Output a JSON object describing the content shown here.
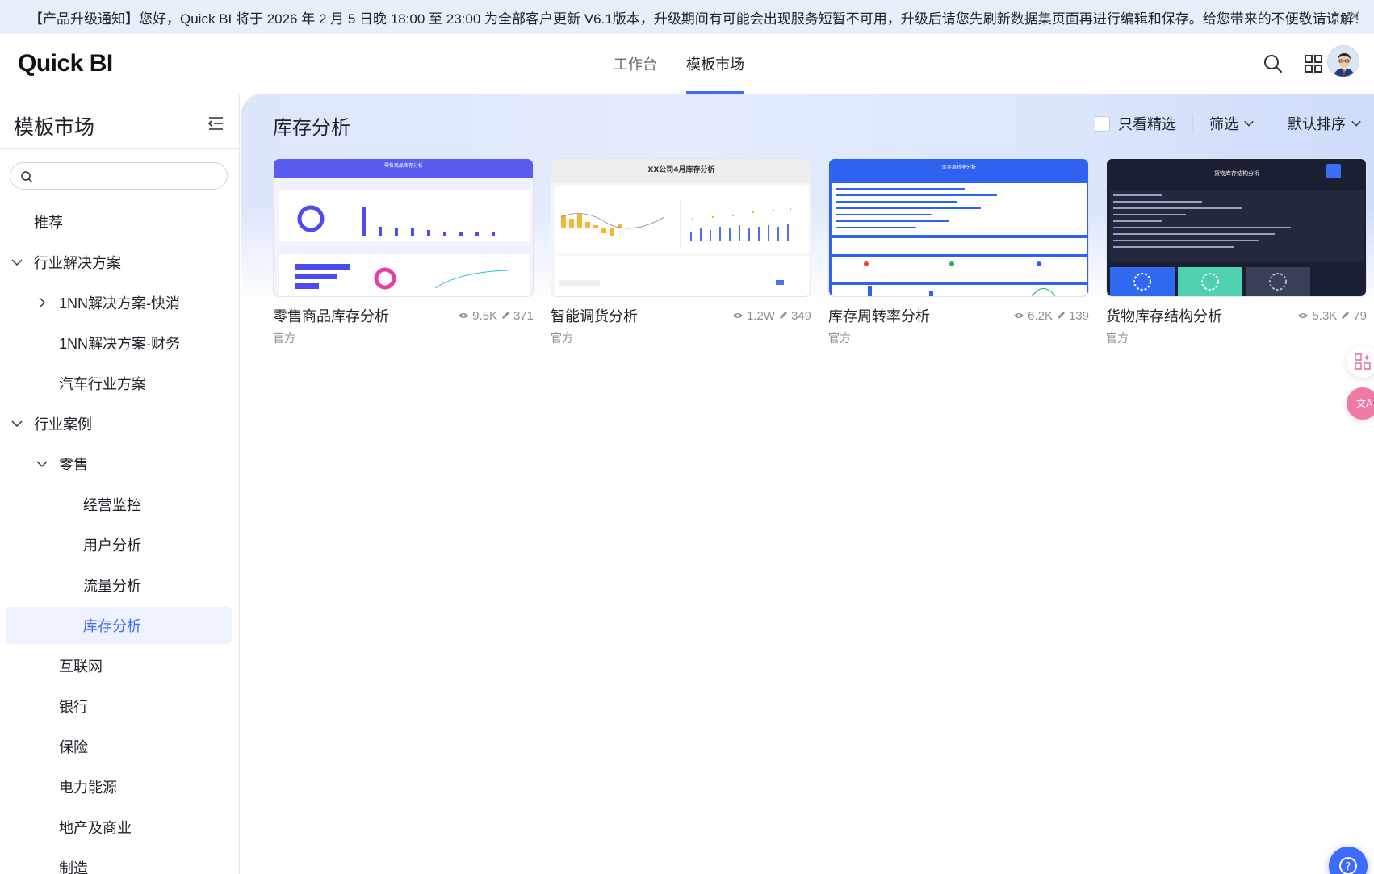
{
  "banner": {
    "text": "【产品升级通知】您好，Quick BI 将于 2026 年 2 月 5 日晚 18:00 至 23:00 为全部客户更新 V6.1版本，升级期间有可能会出现服务短暂不可用，升级后请您先刷新数据集页面再进行编辑和保存。给您带来的不便敬请谅解！",
    "close_icon": "close-icon"
  },
  "header": {
    "logo": "Quick BI",
    "nav": [
      {
        "label": "工作台",
        "active": false
      },
      {
        "label": "模板市场",
        "active": true
      }
    ],
    "accent": "#3d6aff"
  },
  "sidebar": {
    "title": "模板市场",
    "search_placeholder": "",
    "items": [
      {
        "label": "推荐",
        "level": 1,
        "chevron": "none"
      },
      {
        "label": "行业解决方案",
        "level": 0,
        "chevron": "down"
      },
      {
        "label": "1NN解决方案-快消",
        "level": 1,
        "chevron": "right"
      },
      {
        "label": "1NN解决方案-财务",
        "level": 2,
        "chevron": "none"
      },
      {
        "label": "汽车行业方案",
        "level": 2,
        "chevron": "none"
      },
      {
        "label": "行业案例",
        "level": 0,
        "chevron": "down"
      },
      {
        "label": "零售",
        "level": 1,
        "chevron": "down"
      },
      {
        "label": "经营监控",
        "level": 3,
        "chevron": "none"
      },
      {
        "label": "用户分析",
        "level": 3,
        "chevron": "none"
      },
      {
        "label": "流量分析",
        "level": 3,
        "chevron": "none"
      },
      {
        "label": "库存分析",
        "level": 3,
        "chevron": "none",
        "selected": true
      },
      {
        "label": "互联网",
        "level": 2,
        "chevron": "none"
      },
      {
        "label": "银行",
        "level": 2,
        "chevron": "none"
      },
      {
        "label": "保险",
        "level": 2,
        "chevron": "none"
      },
      {
        "label": "电力能源",
        "level": 2,
        "chevron": "none"
      },
      {
        "label": "地产及商业",
        "level": 2,
        "chevron": "none"
      },
      {
        "label": "制造",
        "level": 2,
        "chevron": "none"
      }
    ]
  },
  "main": {
    "title": "库存分析",
    "filter_featured": "只看精选",
    "filter_label": "筛选",
    "sort_label": "默认排序",
    "cards": [
      {
        "name": "零售商品库存分析",
        "views": "9.5K",
        "edits": "371",
        "tag": "官方",
        "thumb_title": "零售商品库存分析",
        "theme": "light-purple"
      },
      {
        "name": "智能调货分析",
        "views": "1.2W",
        "edits": "349",
        "tag": "官方",
        "thumb_title": "XX公司4月库存分析",
        "theme": "light-gray"
      },
      {
        "name": "库存周转率分析",
        "views": "6.2K",
        "edits": "139",
        "tag": "官方",
        "thumb_title": "库存周转率分析",
        "theme": "blue"
      },
      {
        "name": "货物库存结构分析",
        "views": "5.3K",
        "edits": "79",
        "tag": "官方",
        "thumb_title": "货物库存结构分析",
        "theme": "dark"
      }
    ]
  }
}
